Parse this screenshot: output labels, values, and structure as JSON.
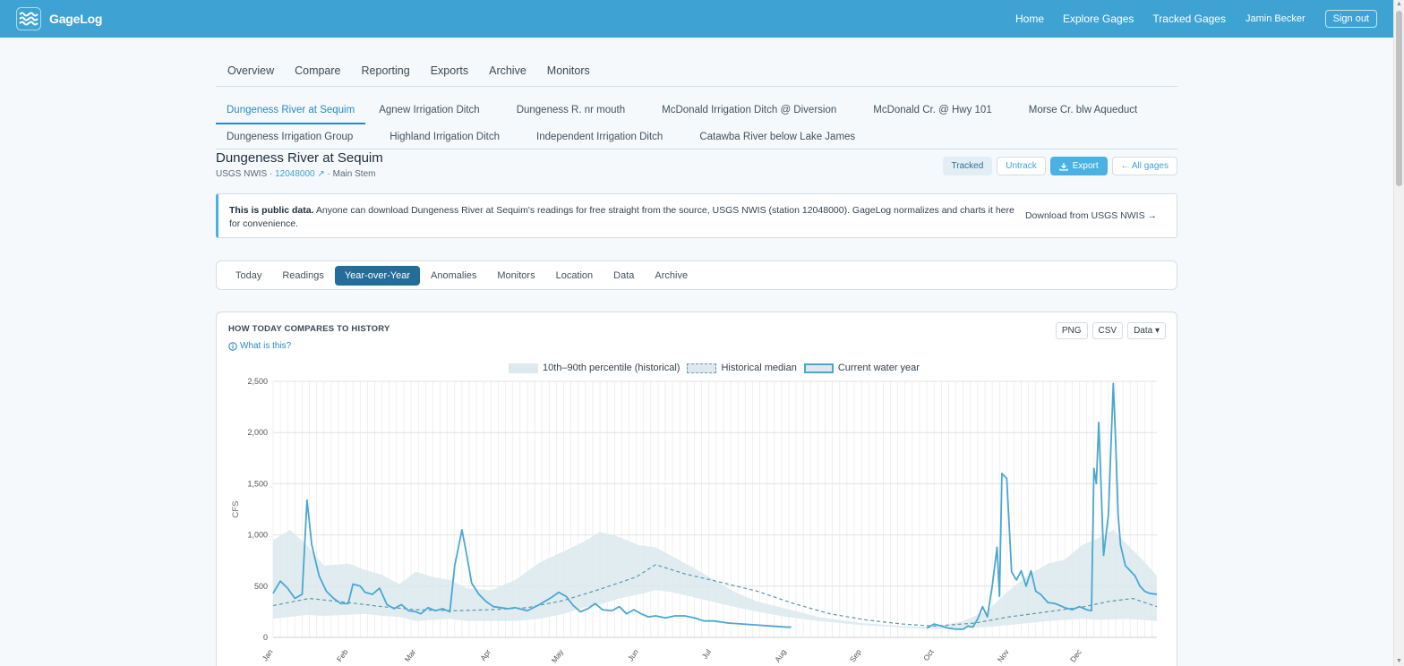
{
  "app": {
    "name": "GageLog",
    "logo_icon": "waves-logo-icon"
  },
  "topnav": {
    "home": "Home",
    "explore": "Explore Gages",
    "tracked": "Tracked Gages",
    "user": "Jamin Becker",
    "signout": "Sign out"
  },
  "section_tabs": [
    "Overview",
    "Compare",
    "Reporting",
    "Exports",
    "Archive",
    "Monitors"
  ],
  "gage_tabs": {
    "row1": [
      "Dungeness River at Sequim",
      "Agnew Irrigation Ditch",
      "Dungeness R. nr mouth",
      "McDonald Irrigation Ditch @ Diversion",
      "McDonald Cr. @ Hwy 101",
      "Morse Cr. blw Aqueduct"
    ],
    "row2": [
      "Dungeness Irrigation Group",
      "Highland Irrigation Ditch",
      "Independent Irrigation Ditch",
      "Catawba River below Lake James"
    ],
    "active": "Dungeness River at Sequim"
  },
  "gage": {
    "title": "Dungeness River at Sequim",
    "source": "USGS NWIS · ",
    "station": "12048000 ↗",
    "suffix": " · Main Stem"
  },
  "actions": {
    "tracked": "Tracked",
    "untrack": "Untrack",
    "export": "Export",
    "all_gages": "← All gages"
  },
  "notice": {
    "bold": "This is public data.",
    "text": " Anyone can download Dungeness River at Sequim's readings for free straight from the source, USGS NWIS (station 12048000). GageLog normalizes and charts it here for convenience.",
    "link": "Download from USGS NWIS →"
  },
  "view_tabs": [
    "Today",
    "Readings",
    "Year-over-Year",
    "Anomalies",
    "Monitors",
    "Location",
    "Data",
    "Archive"
  ],
  "active_view": "Year-over-Year",
  "card": {
    "title": "HOW TODAY COMPARES TO HISTORY",
    "whatis": "What is this?",
    "buttons": {
      "png": "PNG",
      "csv": "CSV",
      "data": "Data ▾"
    }
  },
  "colors": {
    "accent": "#3ea3d3",
    "band": "#dce9ee",
    "median": "#5e98ab",
    "current": "#4aa7d1",
    "active_tab": "#226d99"
  },
  "chart_data": {
    "type": "line",
    "ylabel": "CFS",
    "ylim": [
      0,
      2500
    ],
    "yticks": [
      0,
      500,
      1000,
      1500,
      2000,
      2500
    ],
    "ytick_labels": [
      "0",
      "500",
      "1,000",
      "1,500",
      "2,000",
      "2,500"
    ],
    "xticks": [
      "Jan",
      "Feb",
      "Mar",
      "Apr",
      "May",
      "Jun",
      "Jul",
      "Aug",
      "Sep",
      "Oct",
      "Nov",
      "Dec"
    ],
    "x_unit": "day of year",
    "x_range": [
      0,
      365
    ],
    "legend": [
      "10th–90th percentile (historical)",
      "Historical median",
      "Current water year"
    ],
    "legend_position": "top",
    "series": [
      {
        "name": "10th–90th percentile (historical)",
        "x": [
          0,
          7,
          14,
          21,
          31,
          38,
          45,
          52,
          59,
          66,
          73,
          80,
          90,
          100,
          110,
          120,
          128,
          135,
          143,
          151,
          158,
          165,
          172,
          181,
          190,
          200,
          212,
          225,
          243,
          260,
          273,
          285,
          295,
          304,
          312,
          320,
          327,
          334,
          340,
          347,
          353,
          359,
          365
        ],
        "low": [
          180,
          200,
          220,
          210,
          220,
          230,
          210,
          200,
          160,
          170,
          180,
          160,
          160,
          160,
          180,
          230,
          290,
          320,
          380,
          420,
          460,
          440,
          400,
          350,
          300,
          250,
          200,
          160,
          120,
          95,
          80,
          90,
          100,
          120,
          140,
          160,
          170,
          180,
          170,
          175,
          180,
          170,
          160
        ],
        "high": [
          950,
          1050,
          900,
          700,
          720,
          660,
          610,
          520,
          640,
          590,
          560,
          480,
          460,
          560,
          730,
          840,
          930,
          1030,
          980,
          900,
          880,
          790,
          700,
          580,
          450,
          350,
          280,
          200,
          140,
          110,
          100,
          160,
          260,
          460,
          610,
          720,
          760,
          900,
          960,
          1050,
          900,
          760,
          600
        ]
      },
      {
        "name": "Historical median",
        "x": [
          0,
          15,
          31,
          45,
          59,
          75,
          90,
          105,
          120,
          135,
          150,
          158,
          170,
          181,
          200,
          215,
          230,
          245,
          260,
          273,
          290,
          304,
          320,
          335,
          345,
          355,
          365
        ],
        "values": [
          310,
          380,
          340,
          300,
          270,
          260,
          270,
          290,
          360,
          470,
          590,
          710,
          620,
          560,
          450,
          330,
          230,
          170,
          130,
          110,
          140,
          200,
          250,
          300,
          350,
          380,
          300
        ]
      },
      {
        "name": "Current water year",
        "x": [
          0,
          3,
          6,
          9,
          12,
          14,
          16,
          19,
          22,
          25,
          28,
          31,
          33,
          36,
          38,
          41,
          44,
          47,
          50,
          53,
          56,
          59,
          61,
          64,
          67,
          70,
          73,
          75,
          78,
          80,
          82,
          85,
          88,
          91,
          94,
          97,
          100,
          105,
          110,
          115,
          118,
          121,
          124,
          127,
          130,
          133,
          136,
          140,
          143,
          146,
          149,
          152,
          155,
          158,
          162,
          166,
          170,
          174,
          178,
          182,
          188,
          194,
          200,
          206,
          212,
          214
        ],
        "values": [
          430,
          550,
          480,
          380,
          420,
          1340,
          900,
          600,
          450,
          380,
          330,
          330,
          520,
          500,
          440,
          420,
          480,
          320,
          280,
          320,
          260,
          250,
          230,
          290,
          260,
          280,
          250,
          700,
          1050,
          800,
          530,
          420,
          350,
          300,
          290,
          280,
          290,
          260,
          320,
          390,
          440,
          400,
          310,
          250,
          280,
          330,
          270,
          260,
          300,
          230,
          270,
          230,
          200,
          210,
          190,
          210,
          210,
          190,
          160,
          160,
          140,
          130,
          120,
          110,
          100,
          100
        ]
      },
      {
        "name": "Current water year (late)",
        "x": [
          270,
          273,
          276,
          279,
          282,
          285,
          287,
          289,
          291,
          293,
          295,
          297,
          299,
          300,
          301,
          303,
          305,
          307,
          309,
          311,
          313,
          315,
          317,
          320,
          323,
          327,
          330,
          333,
          336,
          338,
          339,
          340,
          341,
          343,
          345,
          347,
          348,
          349,
          350,
          352,
          354,
          356,
          358,
          360,
          362,
          365
        ],
        "values": [
          90,
          130,
          110,
          90,
          80,
          80,
          110,
          100,
          180,
          300,
          200,
          500,
          880,
          400,
          1600,
          1550,
          640,
          560,
          650,
          500,
          650,
          450,
          420,
          340,
          330,
          290,
          270,
          300,
          270,
          260,
          1650,
          1500,
          2100,
          800,
          1200,
          2480,
          1900,
          1200,
          900,
          700,
          650,
          600,
          500,
          450,
          430,
          420
        ]
      }
    ]
  }
}
